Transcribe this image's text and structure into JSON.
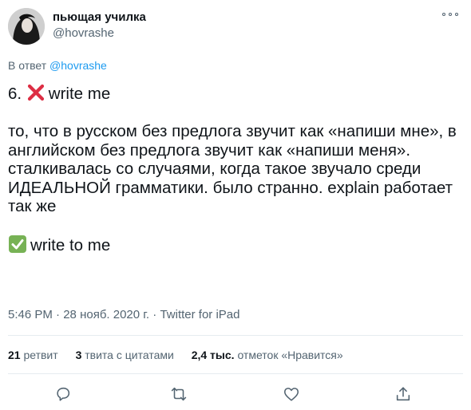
{
  "author": {
    "display_name": "пьющая училка",
    "handle": "@hovrashe",
    "avatar_icon": "avatar-photo"
  },
  "reply": {
    "prefix": "В ответ",
    "handle": "@hovrashe"
  },
  "tweet": {
    "line1_icon": "red-cross-mark",
    "line1_text": "6. ",
    "line1_after": "write me",
    "paragraph": "то, что в русском без предлога звучит как «напиши мне», в английском без предлога звучит как «напиши меня». сталкивалась со случаями, когда такое звучало среди ИДЕАЛЬНОЙ грамматики. было странно. explain работает так же",
    "line3_icon": "green-check-mark",
    "line3_text": "write to me"
  },
  "meta": {
    "time": "5:46 PM",
    "separator": " · ",
    "date": "28 нояб. 2020 г.",
    "source": "Twitter for iPad"
  },
  "stats": {
    "retweets_count": "21",
    "retweets_label": "ретвит",
    "quotes_count": "3",
    "quotes_label": "твита с цитатами",
    "likes_count": "2,4 тыс.",
    "likes_label": "отметок «Нравится»"
  },
  "actions": [
    "reply-icon",
    "retweet-icon",
    "like-icon",
    "share-icon"
  ],
  "colors": {
    "accent": "#1d9bf0",
    "secondary_text": "#536471",
    "cross": "#dd2e44",
    "check": "#77b255"
  }
}
